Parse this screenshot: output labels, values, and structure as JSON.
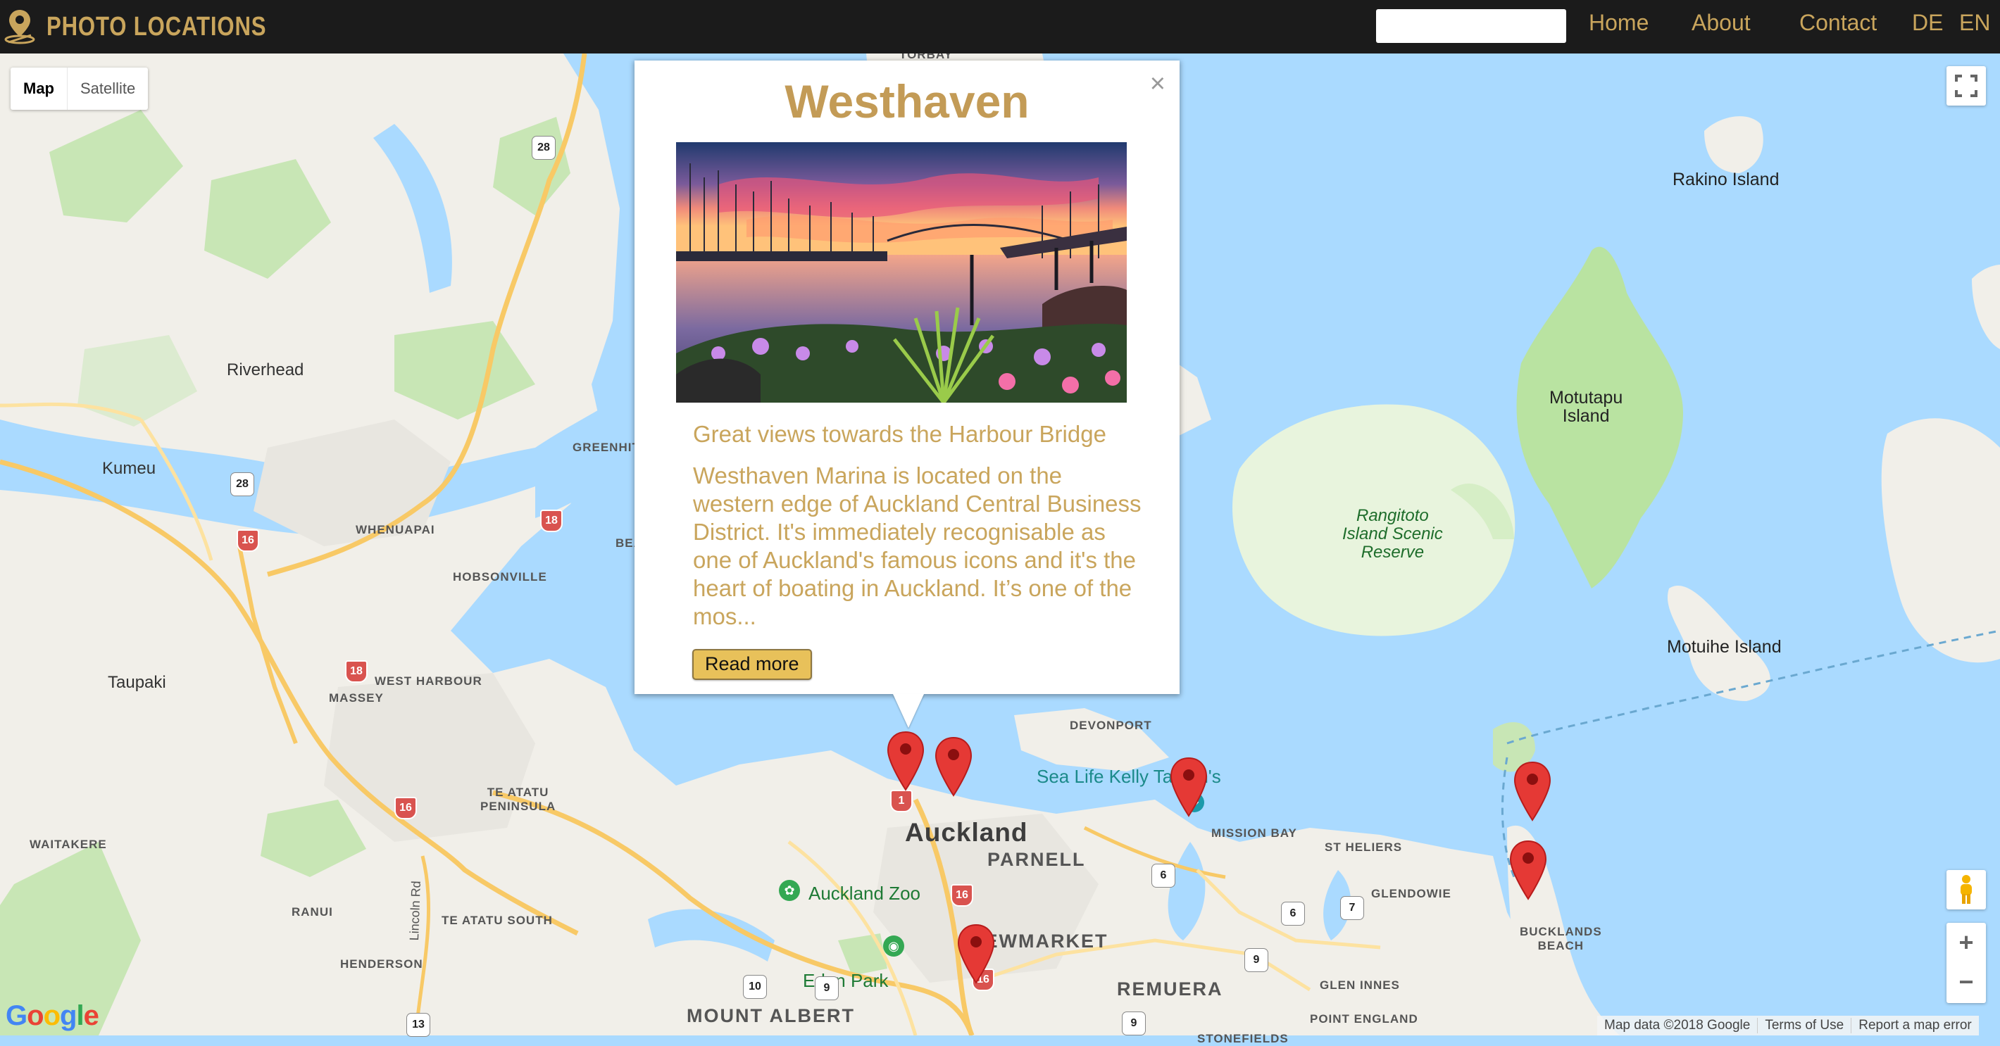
{
  "navbar": {
    "brand": "PHOTO LOCATIONS",
    "search_value": "",
    "links": [
      "Home",
      "About",
      "Contact",
      "DE",
      "EN"
    ]
  },
  "map": {
    "type_buttons": [
      "Map",
      "Satellite"
    ],
    "selected_type": "Map",
    "labels": {
      "riverhead": "Riverhead",
      "kumeu": "Kumeu",
      "taupaki": "Taupaki",
      "whenuapai": "WHENUAPAI",
      "hobsonville": "HOBSONVILLE",
      "massey": "MASSEY",
      "west_harbour": "WEST HARBOUR",
      "te_atatu_peninsula": "TE ATATU\nPENINSULA",
      "waitakere": "WAITAKERE",
      "ranui": "RANUI",
      "te_atatu_south": "TE ATATU SOUTH",
      "henderson": "HENDERSON",
      "lincoln_rd": "Lincoln Rd",
      "greenhithe": "GREENHIT",
      "beach": "BEA",
      "torbay": "TORBAY",
      "devonport": "DEVONPORT",
      "auckland": "Auckland",
      "parnell": "PARNELL",
      "newmarket": "NEWMARKET",
      "remuera": "REMUERA",
      "mount_albert": "MOUNT ALBERT",
      "mission_bay": "MISSION BAY",
      "st_heliers": "ST HELIERS",
      "glendowie": "GLENDOWIE",
      "glen_innes": "GLEN INNES",
      "point_england": "POINT ENGLAND",
      "stonefields": "STONEFIELDS",
      "bucklands_beach": "BUCKLANDS\nBEACH",
      "rakino": "Rakino Island",
      "motutapu": "Motutapu\nIsland",
      "rangitoto": "Rangitoto\nIsland Scenic\nReserve",
      "motuihe": "Motuihe Island",
      "auckland_zoo": "Auckland Zoo",
      "eden_park": "Eden Park",
      "sea_life": "Sea Life Kelly Tarlton's"
    },
    "shields": [
      "28",
      "28",
      "16",
      "18",
      "18",
      "16",
      "16",
      "1",
      "16",
      "6",
      "6",
      "7",
      "9",
      "10",
      "9",
      "13",
      "9"
    ],
    "attribution": [
      "Map data ©2018 Google",
      "Terms of Use",
      "Report a map error"
    ],
    "google": [
      "G",
      "o",
      "o",
      "g",
      "l",
      "e"
    ],
    "zoom_in": "+",
    "zoom_out": "−"
  },
  "info_window": {
    "title": "Westhaven",
    "subtitle": "Great views towards the Harbour Bridge",
    "body": "Westhaven Marina is located on the western edge of Auckland Central Business District. It's immediately recognisable as one of Auckland's famous icons and it's the heart of boating in Auckland. It’s one of the mos...",
    "read_more": "Read more",
    "close": "×"
  },
  "colors": {
    "navbar_bg": "#1b1b1b",
    "brand_gold": "#c9a55c",
    "title_gold": "#c39b56",
    "button_gold": "#e8c15a",
    "water": "#aadaff",
    "marker_red": "#e53935"
  }
}
